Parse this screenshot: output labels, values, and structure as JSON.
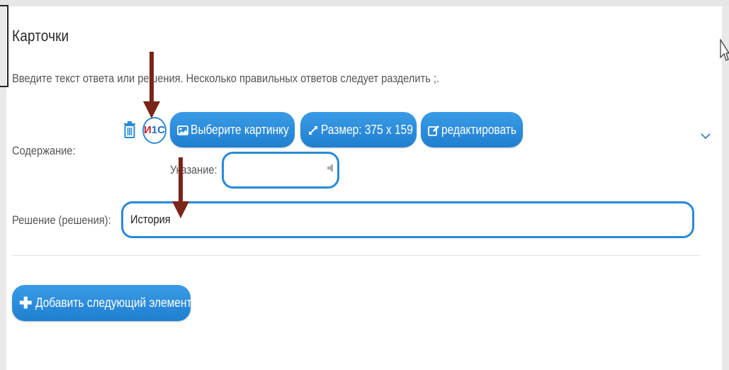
{
  "section": {
    "title": "Карточки",
    "hint": "Введите текст ответа или решения. Несколько правильных ответов следует разделить ;."
  },
  "content": {
    "label": "Содержание:",
    "logo": {
      "red": "И",
      "blue": "1С"
    },
    "buttons": {
      "choose_image": "Выберите картинку",
      "size": "Размер: 375 x 159",
      "edit": "редактировать"
    },
    "hint_label": "Указание:",
    "hint_value": ""
  },
  "solution": {
    "label": "Решение (решения):",
    "value": "История"
  },
  "add_button": "Добавить следующий элемент",
  "colors": {
    "accent": "#2a8ad6",
    "button": "#1f7fd0",
    "annotation_arrow": "#7b2518"
  },
  "icons": [
    "trash-icon",
    "image-icon",
    "resize-icon",
    "edit-icon",
    "chevron-down-icon",
    "speaker-icon",
    "plus-icon",
    "mouse-cursor-icon"
  ]
}
